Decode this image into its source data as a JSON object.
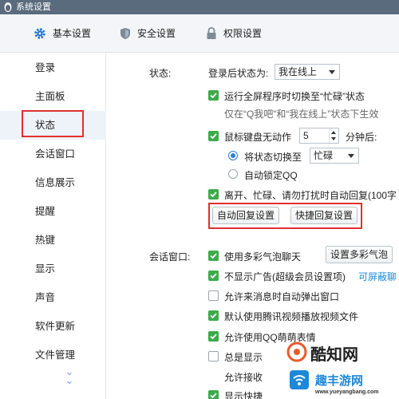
{
  "window": {
    "title": "系统设置"
  },
  "tabs": [
    {
      "label": "基本设置",
      "icon": "gear-icon",
      "active": true
    },
    {
      "label": "安全设置",
      "icon": "shield-icon",
      "active": false
    },
    {
      "label": "权限设置",
      "icon": "lock-icon",
      "active": false
    }
  ],
  "sidebar": {
    "items": [
      {
        "label": "登录"
      },
      {
        "label": "主面板"
      },
      {
        "label": "状态",
        "active": true
      },
      {
        "label": "会话窗口"
      },
      {
        "label": "信息展示"
      },
      {
        "label": "提醒"
      },
      {
        "label": "热键"
      },
      {
        "label": "显示"
      },
      {
        "label": "声音"
      },
      {
        "label": "软件更新"
      },
      {
        "label": "文件管理"
      }
    ]
  },
  "status": {
    "section_label": "状态:",
    "after_login_label": "登录后状态为:",
    "after_login_value": "我在线上",
    "fullscreen_label": "运行全屏程序时切换至“忙碌”状态",
    "fullscreen_checked": true,
    "fullscreen_note": "仅在“Q我吧”和“我在线上”状态下生效",
    "idle_label": "鼠标键盘无动作",
    "idle_checked": true,
    "idle_minutes": "5",
    "idle_unit": "分钟后:",
    "switch_radio_label": "将状态切换至",
    "switch_radio_selected": true,
    "switch_to_value": "忙碌",
    "lock_radio_label": "自动锁定QQ",
    "auto_reply_label": "离开、忙碌、请勿打扰时自动回复(100字",
    "auto_reply_checked": true,
    "auto_reply_button": "自动回复设置",
    "quick_reply_button": "快捷回复设置"
  },
  "session": {
    "section_label": "会话窗口:",
    "bubble_label": "使用多彩气泡聊天",
    "bubble_checked": true,
    "bubble_button": "设置多彩气泡",
    "no_ads_label": "不显示广告(超级会员设置项)",
    "no_ads_checked": true,
    "no_ads_link": "可屏蔽聊",
    "popup_label": "允许来消息时自动弹出窗口",
    "popup_checked": false,
    "video_label": "默认使用腾讯视频播放视频文件",
    "video_checked": true,
    "qq_cute_label": "允许使用QQ萌萌表情",
    "qq_cute_checked": true,
    "row6_label": "总是显示",
    "row6_checked": false,
    "row7_label": "允许接收",
    "row8_label": "显示快捷",
    "row8_checked": true
  },
  "watermark": {
    "brand_cn": "酷知网",
    "site_cn": "趣丰游网",
    "site_url": "www.yueyangbang.com"
  },
  "colors": {
    "accent": "#1a73c8",
    "check_green": "#3cab4b",
    "highlight_red": "#e03030",
    "titlebar": "#5a6b7d"
  }
}
